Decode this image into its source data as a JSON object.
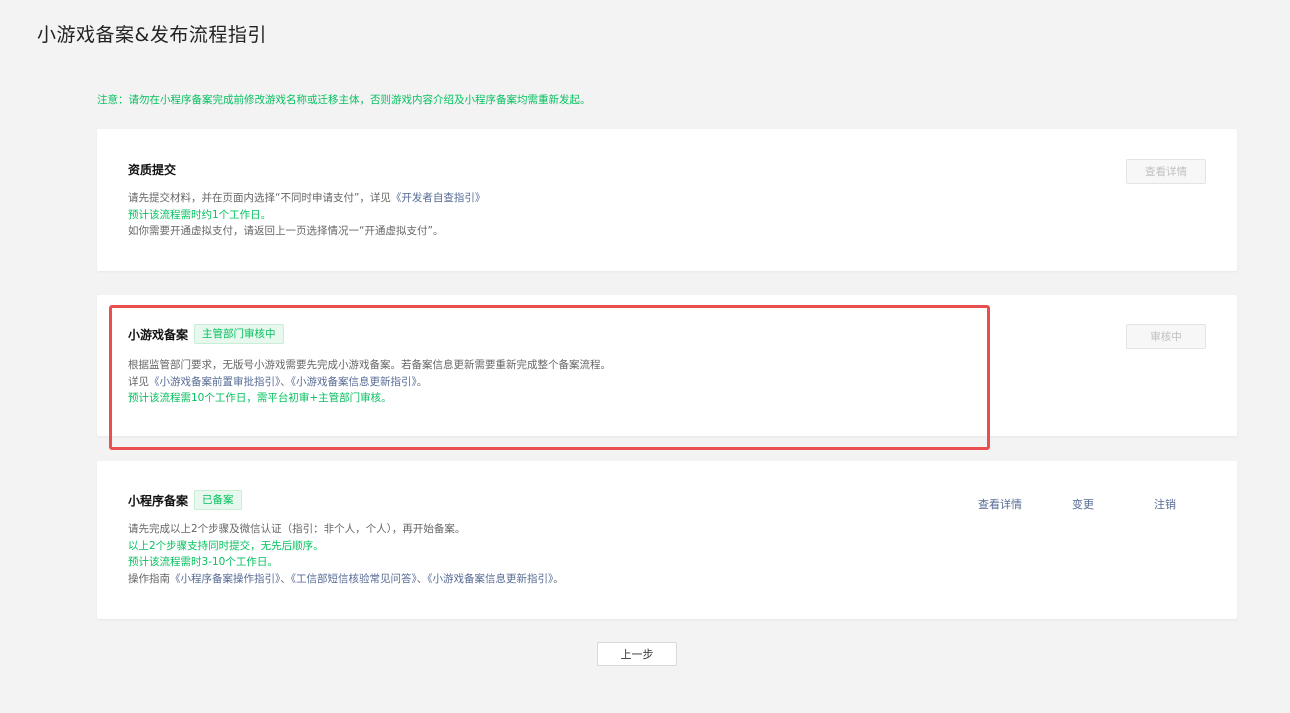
{
  "page": {
    "title": "小游戏备案&发布流程指引",
    "notice": "注意：请勿在小程序备案完成前修改游戏名称或迁移主体，否则游戏内容介绍及小程序备案均需重新发起。"
  },
  "cards": [
    {
      "title": "资质提交",
      "button": "查看详情",
      "lines": [
        {
          "pre": "请先提交材料，并在页面内选择“不同时申请支付”，详见",
          "link": "《开发者自查指引》"
        },
        {
          "text": "预计该流程需时约1个工作日。"
        },
        {
          "text": "如你需要开通虚拟支付，请返回上一页选择情况一“开通虚拟支付”。"
        }
      ]
    },
    {
      "title": "小游戏备案",
      "badge": "主管部门审核中",
      "button": "审核中",
      "lines": [
        {
          "text": "根据监管部门要求，无版号小游戏需要先完成小游戏备案。若备案信息更新需要重新完成整个备案流程。"
        },
        {
          "pre": "详见",
          "link1": "《小游戏备案前置审批指引》",
          "mid": "、",
          "link2": "《小游戏备案信息更新指引》",
          "post": "。"
        },
        {
          "text": "预计该流程需10个工作日，需平台初审+主管部门审核。"
        }
      ]
    },
    {
      "title": "小程序备案",
      "badge": "已备案",
      "actions": [
        "查看详情",
        "变更",
        "注销"
      ],
      "lines": [
        {
          "text": "请先完成以上2个步骤及微信认证（指引：非个人，个人），再开始备案。"
        },
        {
          "text": "以上2个步骤支持同时提交，无先后顺序。"
        },
        {
          "text": "预计该流程需时3-10个工作日。"
        },
        {
          "pre": "操作指南",
          "link1": "《小程序备案操作指引》",
          "mid1": "、",
          "link2": "《工信部短信核验常见问答》",
          "mid2": "、",
          "link3": "《小游戏备案信息更新指引》",
          "post": "。"
        }
      ]
    }
  ],
  "footer": {
    "prev_button": "上一步"
  },
  "colors": {
    "accent_green": "#07c160",
    "link": "#576b95",
    "highlight_red": "#e94f4f"
  }
}
